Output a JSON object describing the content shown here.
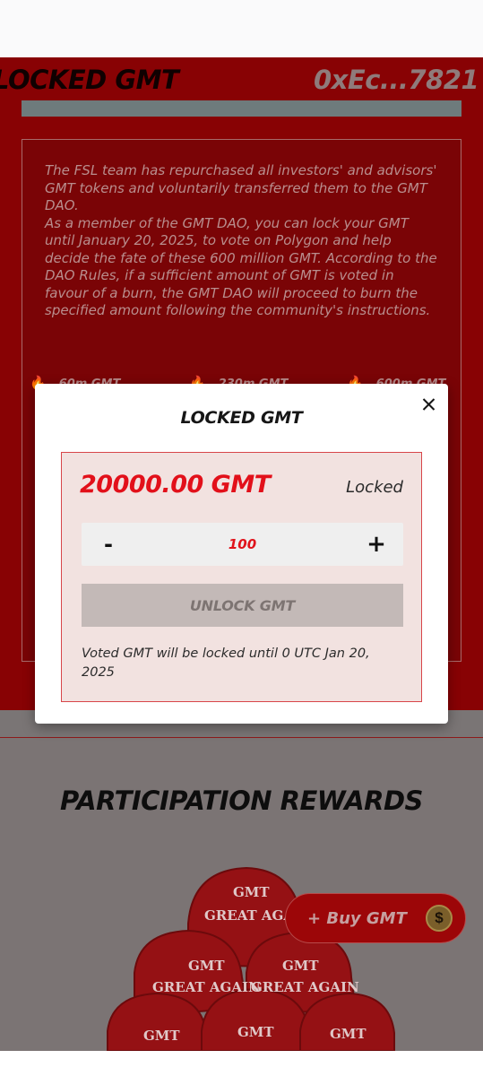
{
  "background": {
    "hero_title": "LOCKED GMT",
    "wallet": "0xEc...7821",
    "description": [
      "The FSL team has repurchased all investors' and advisors' GMT tokens and voluntarily transferred them to the GMT DAO.",
      "As a member of the GMT DAO, you can lock your GMT until January 20, 2025, to vote on Polygon and help decide the fate of these 600 million GMT. According to the DAO Rules, if a sufficient amount of GMT is voted in favour of a burn, the GMT DAO will proceed to burn the specified amount following the community's instructions."
    ],
    "stats": [
      "60m GMT",
      "230m GMT",
      "600m GMT"
    ],
    "rewards_title": "PARTICIPATION REWARDS",
    "hat_text": [
      "GMT",
      "GREAT AGAIN"
    ],
    "buy_button": "+ Buy GMT",
    "buy_icon": "gmt-coin-icon"
  },
  "modal": {
    "title": "LOCKED GMT",
    "amount": "20000.00 GMT",
    "status": "Locked",
    "stepper": {
      "minus": "-",
      "value": "100",
      "plus": "+"
    },
    "unlock_button": "UNLOCK GMT",
    "note": "Voted GMT will be locked until 0 UTC Jan 20, 2025",
    "close_icon": "close-icon"
  },
  "colors": {
    "hero_bg": "#880204",
    "accent_red": "#e2101a",
    "panel_bg": "#f2e2e0",
    "panel_border": "#d8464a",
    "button_disabled": "#c3b9b7"
  }
}
